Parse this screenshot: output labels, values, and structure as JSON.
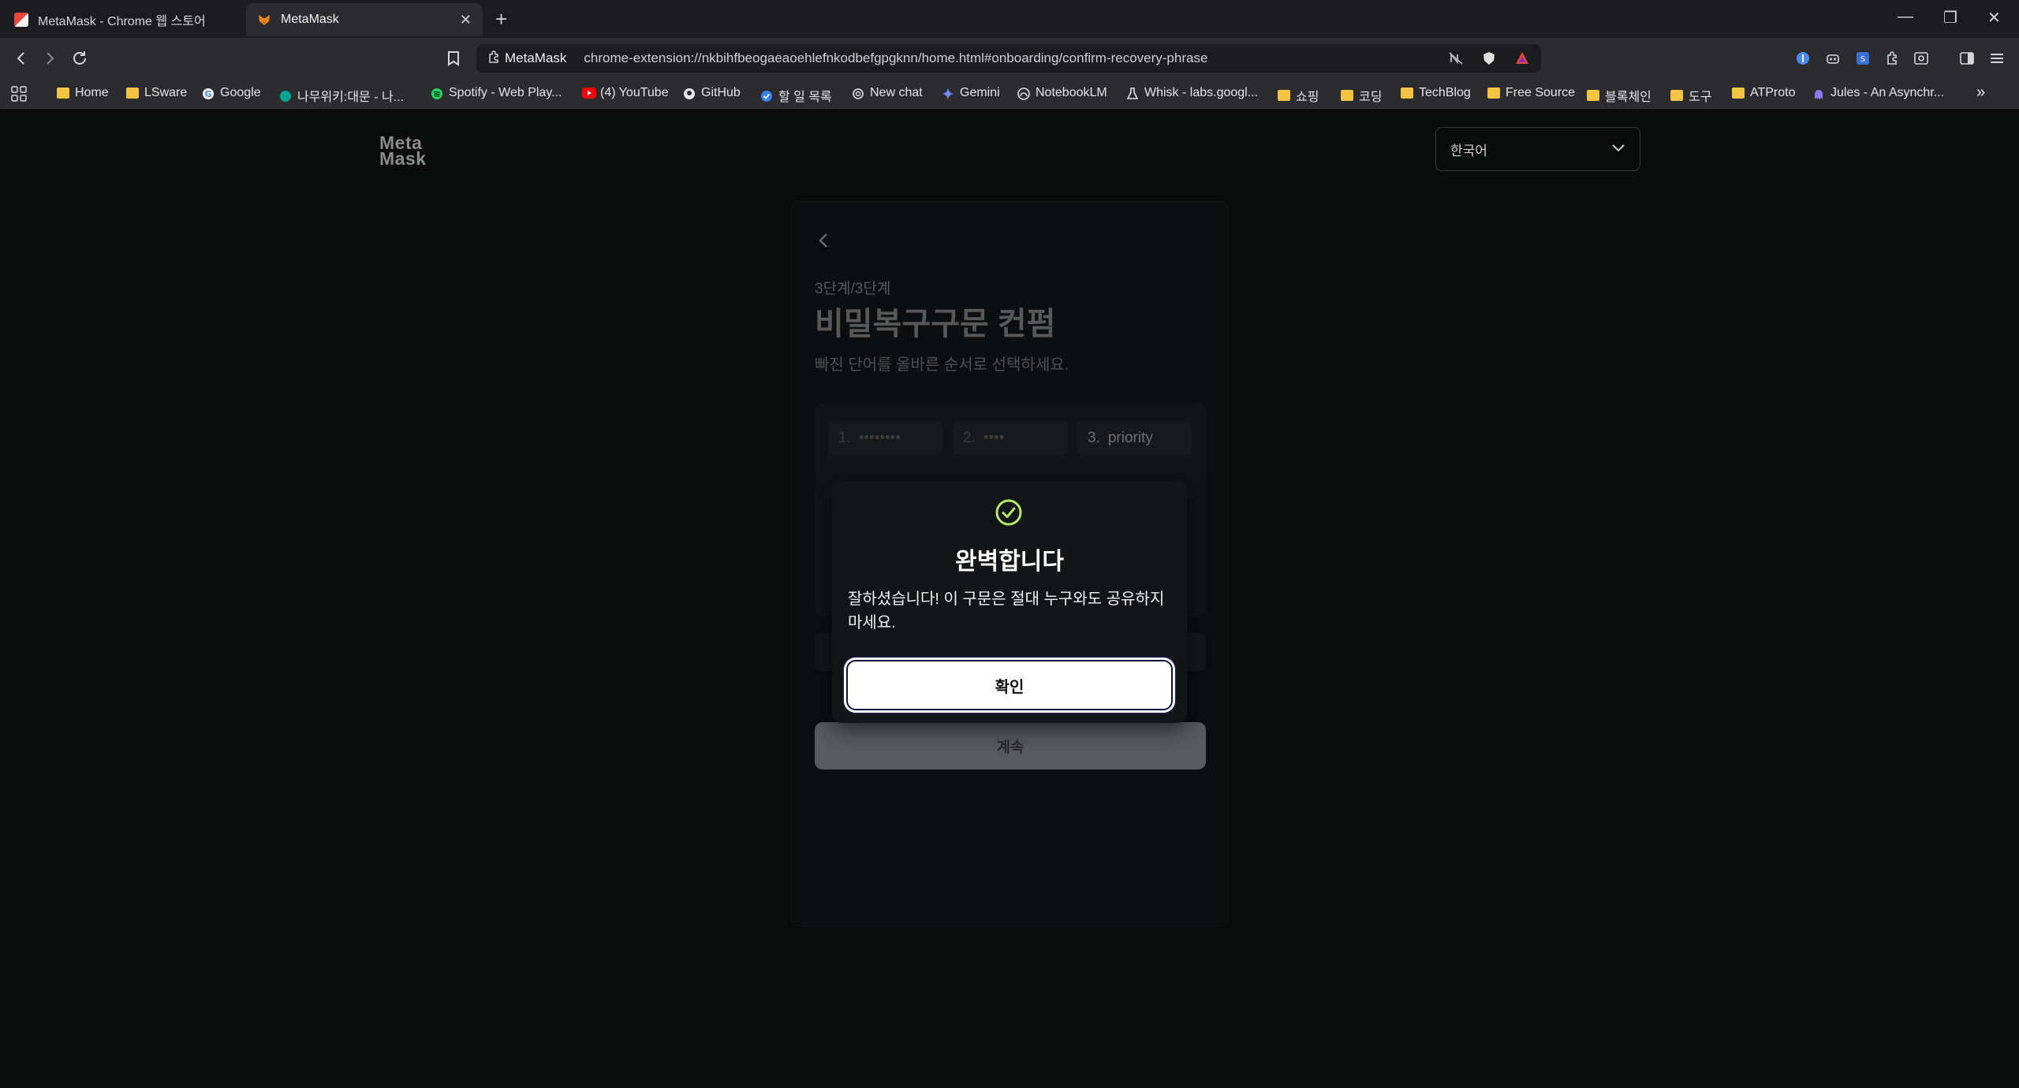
{
  "browser": {
    "tabs": [
      {
        "title": "MetaMask - Chrome 웹 스토어",
        "active": false
      },
      {
        "title": "MetaMask",
        "active": true
      }
    ],
    "new_tab": "+",
    "close_tab": "✕",
    "window_controls": {
      "minimize": "—",
      "restore": "❐",
      "close": "✕"
    },
    "address": {
      "site_name": "MetaMask",
      "url": "chrome-extension://nkbihfbeogaeaoehlefnkodbefgpgknn/home.html#onboarding/confirm-recovery-phrase"
    },
    "bookmarks": [
      {
        "label": "Home",
        "icon": "folder-icon"
      },
      {
        "label": "LSware",
        "icon": "folder-icon"
      },
      {
        "label": "Google",
        "icon": "google-icon"
      },
      {
        "label": "나무위키:대문 - 나...",
        "icon": "namuwiki-icon"
      },
      {
        "label": "Spotify - Web Play...",
        "icon": "spotify-icon"
      },
      {
        "label": "(4) YouTube",
        "icon": "youtube-icon"
      },
      {
        "label": "GitHub",
        "icon": "github-icon"
      },
      {
        "label": "할 일 목록",
        "icon": "todo-icon"
      },
      {
        "label": "New chat",
        "icon": "openai-icon"
      },
      {
        "label": "Gemini",
        "icon": "gemini-icon"
      },
      {
        "label": "NotebookLM",
        "icon": "notebooklm-icon"
      },
      {
        "label": "Whisk - labs.googl...",
        "icon": "whisk-icon"
      },
      {
        "label": "쇼핑",
        "icon": "folder-icon"
      },
      {
        "label": "코딩",
        "icon": "folder-icon"
      },
      {
        "label": "TechBlog",
        "icon": "folder-icon"
      },
      {
        "label": "Free Source",
        "icon": "folder-icon"
      },
      {
        "label": "블록체인",
        "icon": "folder-icon"
      },
      {
        "label": "도구",
        "icon": "folder-icon"
      },
      {
        "label": "ATProto",
        "icon": "folder-icon"
      },
      {
        "label": "Jules - An Asynchr...",
        "icon": "jules-icon"
      }
    ],
    "more_bookmarks": "»"
  },
  "page": {
    "logo_line1": "Meta",
    "logo_line2": "Mask",
    "language": "한국어",
    "step": "3단계/3단계",
    "title": "비밀복구구문 컨펌",
    "subtitle": "빠진 단어를 올바른 순서로 선택하세요.",
    "words": [
      {
        "num": "1.",
        "text": "••••••••"
      },
      {
        "num": "2.",
        "text": "••••"
      },
      {
        "num": "3.",
        "text": "priority"
      }
    ],
    "continue_label": "계속"
  },
  "modal": {
    "title": "완벽합니다",
    "body": "잘하셨습니다! 이 구문은 절대 누구와도 공유하지 마세요.",
    "confirm_label": "확인",
    "accent": "#b6e86a"
  }
}
